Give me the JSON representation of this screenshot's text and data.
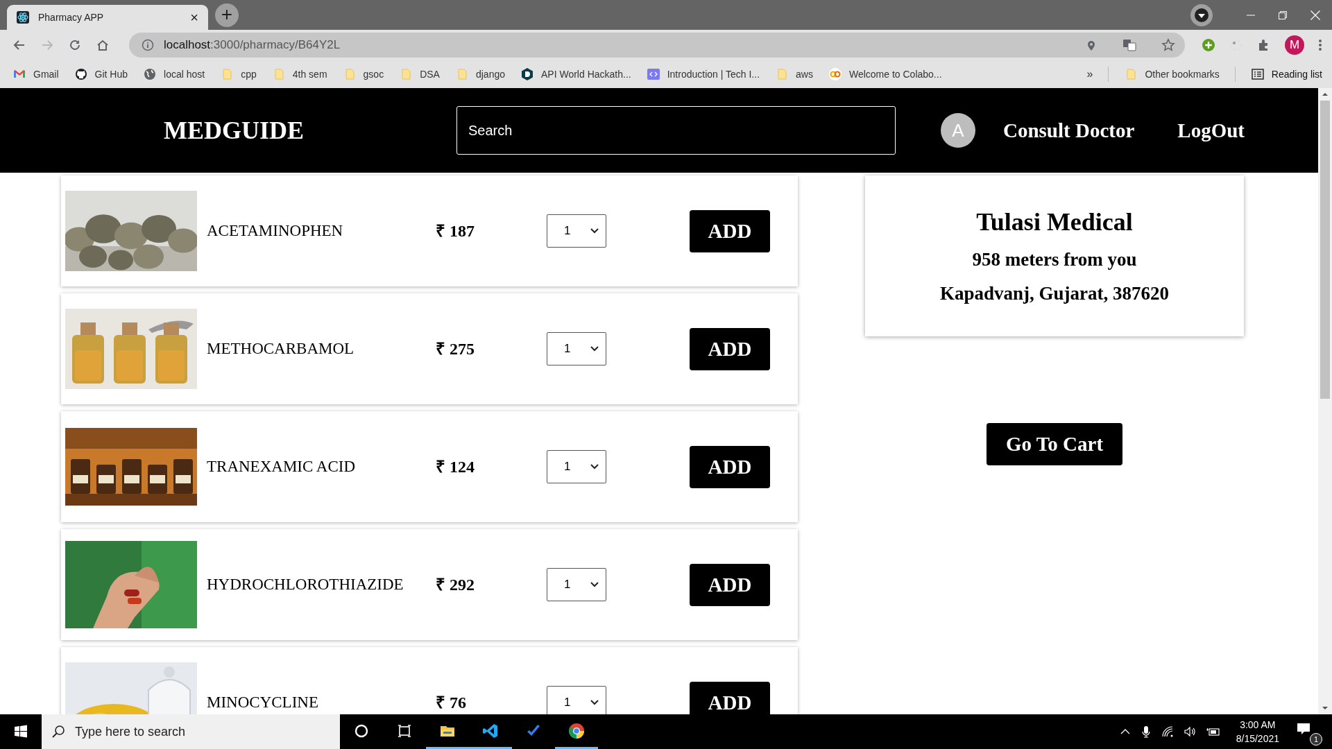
{
  "browser": {
    "tab": {
      "title": "Pharmacy APP",
      "close": "×"
    },
    "new_tab": "+",
    "address": {
      "host": "localhost",
      "rest": ":3000/pharmacy/B64Y2L"
    },
    "bookmarks": [
      {
        "label": "Gmail",
        "kind": "gmail"
      },
      {
        "label": "Git Hub",
        "kind": "github"
      },
      {
        "label": "local host",
        "kind": "globe"
      },
      {
        "label": "cpp",
        "kind": "folder"
      },
      {
        "label": "4th sem",
        "kind": "folder"
      },
      {
        "label": "gsoc",
        "kind": "folder"
      },
      {
        "label": "DSA",
        "kind": "folder"
      },
      {
        "label": "django",
        "kind": "folder"
      },
      {
        "label": "API World Hackath...",
        "kind": "d"
      },
      {
        "label": "Introduction | Tech I...",
        "kind": "code"
      },
      {
        "label": "aws",
        "kind": "folder"
      },
      {
        "label": "Welcome to Colabo...",
        "kind": "colab"
      }
    ],
    "more": "»",
    "other_bookmarks": "Other bookmarks",
    "reading_list": "Reading list",
    "profile": "M"
  },
  "header": {
    "logo": "MEDGUIDE",
    "search": {
      "placeholder": "Search"
    },
    "avatar": "A",
    "links": [
      "Consult Doctor",
      "LogOut"
    ]
  },
  "products": [
    {
      "name": "ACETAMINOPHEN",
      "price": "₹ 187",
      "quantity": "1",
      "button": "ADD"
    },
    {
      "name": "METHOCARBAMOL",
      "price": "₹ 275",
      "quantity": "1",
      "button": "ADD"
    },
    {
      "name": "TRANEXAMIC ACID",
      "price": "₹ 124",
      "quantity": "1",
      "button": "ADD"
    },
    {
      "name": "HYDROCHLOROTHIAZIDE",
      "price": "₹ 292",
      "quantity": "1",
      "button": "ADD"
    },
    {
      "name": "MINOCYCLINE",
      "price": "₹ 76",
      "quantity": "1",
      "button": "ADD"
    }
  ],
  "store": {
    "name": "Tulasi Medical",
    "distance": "958 meters from you",
    "address": "Kapadvanj, Gujarat, 387620"
  },
  "cart_button": "Go To Cart",
  "taskbar": {
    "search": {
      "placeholder": "Type here to search"
    },
    "apps": [
      {
        "kind": "cortana",
        "active": false
      },
      {
        "kind": "taskview",
        "active": false
      },
      {
        "kind": "explorer",
        "active": true
      },
      {
        "kind": "vscode",
        "active": true
      },
      {
        "kind": "todo",
        "active": false
      },
      {
        "kind": "chrome",
        "active": true
      }
    ],
    "time": "3:00 AM",
    "date": "8/15/2021",
    "notifications": "1"
  }
}
